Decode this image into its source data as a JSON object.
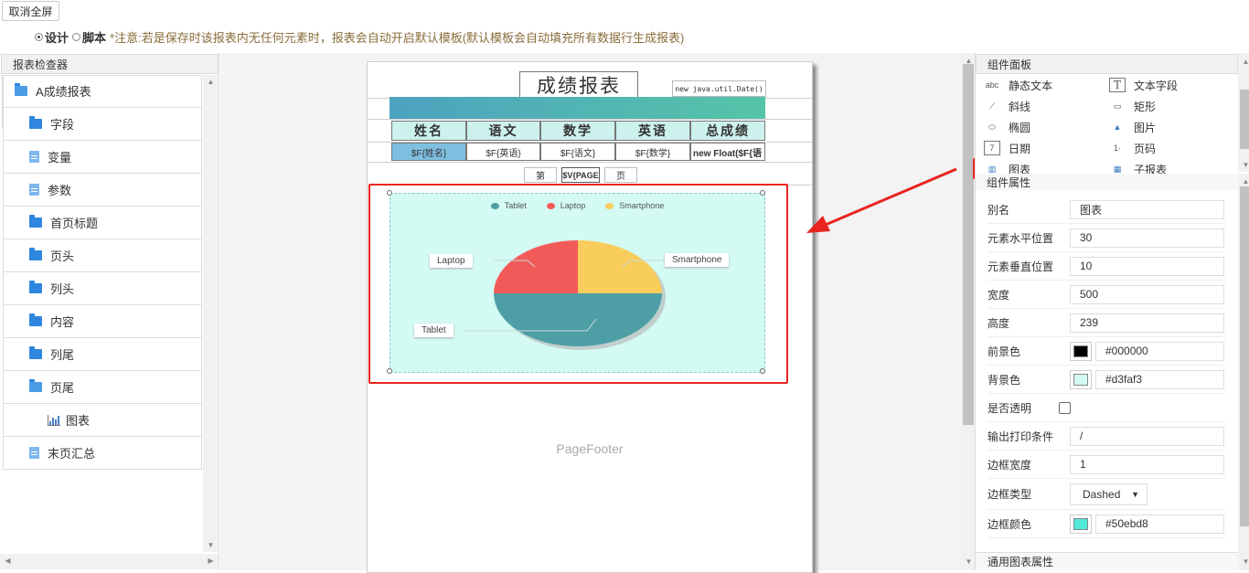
{
  "toolbar": {
    "fullscreen_label": "取消全屏"
  },
  "mode": {
    "design_label": "设计",
    "script_label": "脚本",
    "hint": "*注意:若是保存时该报表内无任何元素时，报表会自动开启默认模板(默认模板会自动填充所有数据行生成报表)"
  },
  "inspector": {
    "title": "报表检查器",
    "items": [
      {
        "label": "A成绩报表",
        "icon": "folder-open-icon"
      },
      {
        "label": "字段",
        "icon": "folder-icon"
      },
      {
        "label": "变量",
        "icon": "file-icon"
      },
      {
        "label": "参数",
        "icon": "file-icon"
      },
      {
        "label": "首页标题",
        "icon": "folder-icon"
      },
      {
        "label": "页头",
        "icon": "folder-icon"
      },
      {
        "label": "列头",
        "icon": "folder-icon"
      },
      {
        "label": "内容",
        "icon": "folder-icon"
      },
      {
        "label": "列尾",
        "icon": "folder-icon"
      },
      {
        "label": "页尾",
        "icon": "folder-open-icon"
      },
      {
        "label": "图表",
        "icon": "chart-icon"
      },
      {
        "label": "末页汇总",
        "icon": "file-icon"
      }
    ]
  },
  "report": {
    "title": "成绩报表",
    "date_expr": "new java.util.Date()",
    "headers": [
      "姓名",
      "语文",
      "数学",
      "英语",
      "总成绩"
    ],
    "cells": [
      "$F{姓名}",
      "$F{英语}",
      "$F{语文}",
      "$F{数学}",
      "new Float($F{语"
    ],
    "page_prefix": "第",
    "page_var": "$V{PAGE",
    "page_suffix": "页",
    "footer": "PageFooter"
  },
  "chart_data": {
    "type": "pie",
    "categories": [
      "Tablet",
      "Laptop",
      "Smartphone"
    ],
    "values": [
      50,
      25,
      25
    ],
    "colors": [
      "#4e9ea6",
      "#f25a5a",
      "#f8cd5c"
    ],
    "legend_position": "top"
  },
  "components": {
    "title": "组件面板",
    "items": [
      {
        "label": "静态文本",
        "icon": "static-text-icon"
      },
      {
        "label": "文本字段",
        "icon": "text-field-icon"
      },
      {
        "label": "斜线",
        "icon": "line-icon"
      },
      {
        "label": "矩形",
        "icon": "rectangle-icon"
      },
      {
        "label": "椭圆",
        "icon": "ellipse-icon"
      },
      {
        "label": "图片",
        "icon": "image-icon"
      },
      {
        "label": "日期",
        "icon": "calendar-icon"
      },
      {
        "label": "页码",
        "icon": "page-number-icon"
      },
      {
        "label": "图表",
        "icon": "chart-icon"
      },
      {
        "label": "子报表",
        "icon": "subreport-icon"
      }
    ]
  },
  "properties": {
    "title": "组件属性",
    "alias": {
      "label": "别名",
      "value": "图表"
    },
    "x": {
      "label": "元素水平位置",
      "value": "30"
    },
    "y": {
      "label": "元素垂直位置",
      "value": "10"
    },
    "width": {
      "label": "宽度",
      "value": "500"
    },
    "height": {
      "label": "高度",
      "value": "239"
    },
    "fg": {
      "label": "前景色",
      "value": "#000000",
      "color": "#000000"
    },
    "bg": {
      "label": "背景色",
      "value": "#d3faf3",
      "color": "#d3faf3"
    },
    "transparent": {
      "label": "是否透明"
    },
    "print_cond": {
      "label": "输出打印条件",
      "value": "/"
    },
    "border_width": {
      "label": "边框宽度",
      "value": "1"
    },
    "border_type": {
      "label": "边框类型",
      "value": "Dashed"
    },
    "border_color": {
      "label": "边框颜色",
      "value": "#50ebd8",
      "color": "#50ebd8"
    },
    "general_chart": "通用图表属性"
  }
}
